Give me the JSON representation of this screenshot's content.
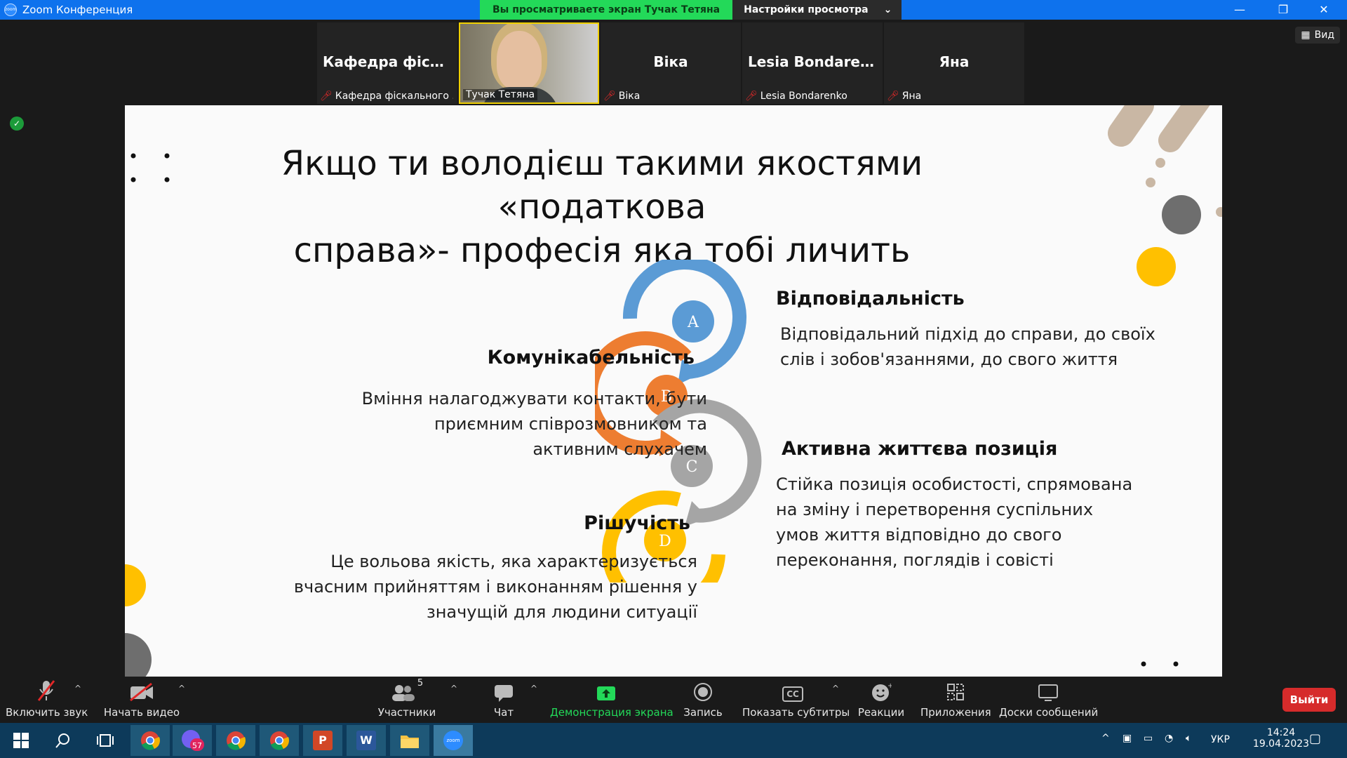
{
  "window": {
    "title": "Zoom Конференция",
    "icon_label": "zoom",
    "controls": {
      "minimize": "—",
      "restore": "❐",
      "close": "✕"
    }
  },
  "share_banner": {
    "viewing_text": "Вы просматриваете экран Тучак Тетяна",
    "view_options_label": "Настройки просмотра"
  },
  "view_button": {
    "label": "Вид"
  },
  "participants_strip": [
    {
      "big_name": "Кафедра фіска...",
      "small_name": "Кафедра фіскального ...",
      "muted": true,
      "video": false
    },
    {
      "big_name": "",
      "small_name": "Тучак Тетяна",
      "muted": false,
      "video": true,
      "speaking": true
    },
    {
      "big_name": "Віка",
      "small_name": "Віка",
      "muted": true,
      "video": false
    },
    {
      "big_name": "Lesia Bondarenko",
      "small_name": "Lesia Bondarenko",
      "muted": true,
      "video": false
    },
    {
      "big_name": "Яна",
      "small_name": "Яна",
      "muted": true,
      "video": false
    }
  ],
  "slide": {
    "title_line1": "Якщо ти володієш такими якостями «податкова",
    "title_line2": "справа»- професія яка тобі личить",
    "letters": [
      "A",
      "B",
      "C",
      "D"
    ],
    "colors": {
      "blue": "#5b9bd5",
      "orange": "#ed7d31",
      "gray": "#a5a5a5",
      "yellow": "#ffc000"
    },
    "items": {
      "a_title": "Відповідальність",
      "a_text_1": "Відповідальний підхід до справи, до своїх",
      "a_text_2": "слів і зобов'язаннями, до свого життя",
      "b_title": "Комунікабельність",
      "b_text_1": "Вміння налагоджувати контакти, бути",
      "b_text_2": "приємним співрозмовником та",
      "b_text_3": "активним слухачем",
      "c_title": "Активна життєва позиція",
      "c_text_1": "Стійка позиція особистості, спрямована",
      "c_text_2": "на зміну і перетворення суспільних",
      "c_text_3": "умов життя відповідно до свого",
      "c_text_4": "переконання, поглядів і совісті",
      "d_title": "Рішучість",
      "d_text_1": "Це вольова якість, яка характеризується",
      "d_text_2": "вчасним прийняттям і виконанням рішення у",
      "d_text_3": "значущій для людини ситуації"
    }
  },
  "toolbar": {
    "unmute": "Включить звук",
    "start_video": "Начать видео",
    "participants": "Участники",
    "participants_count": "5",
    "chat": "Чат",
    "share_screen": "Демонстрация экрана",
    "record": "Запись",
    "captions": "Показать субтитры",
    "captions_icon_text": "CC",
    "reactions": "Реакции",
    "apps": "Приложения",
    "whiteboards": "Доски сообщений",
    "leave": "Выйти",
    "share_color": "#23d959"
  },
  "taskbar": {
    "viber_badge": "57",
    "lang": "УКР",
    "time": "14:24",
    "date": "19.04.2023",
    "zoom_label": "zoom",
    "ppt_label": "P",
    "word_label": "W"
  }
}
